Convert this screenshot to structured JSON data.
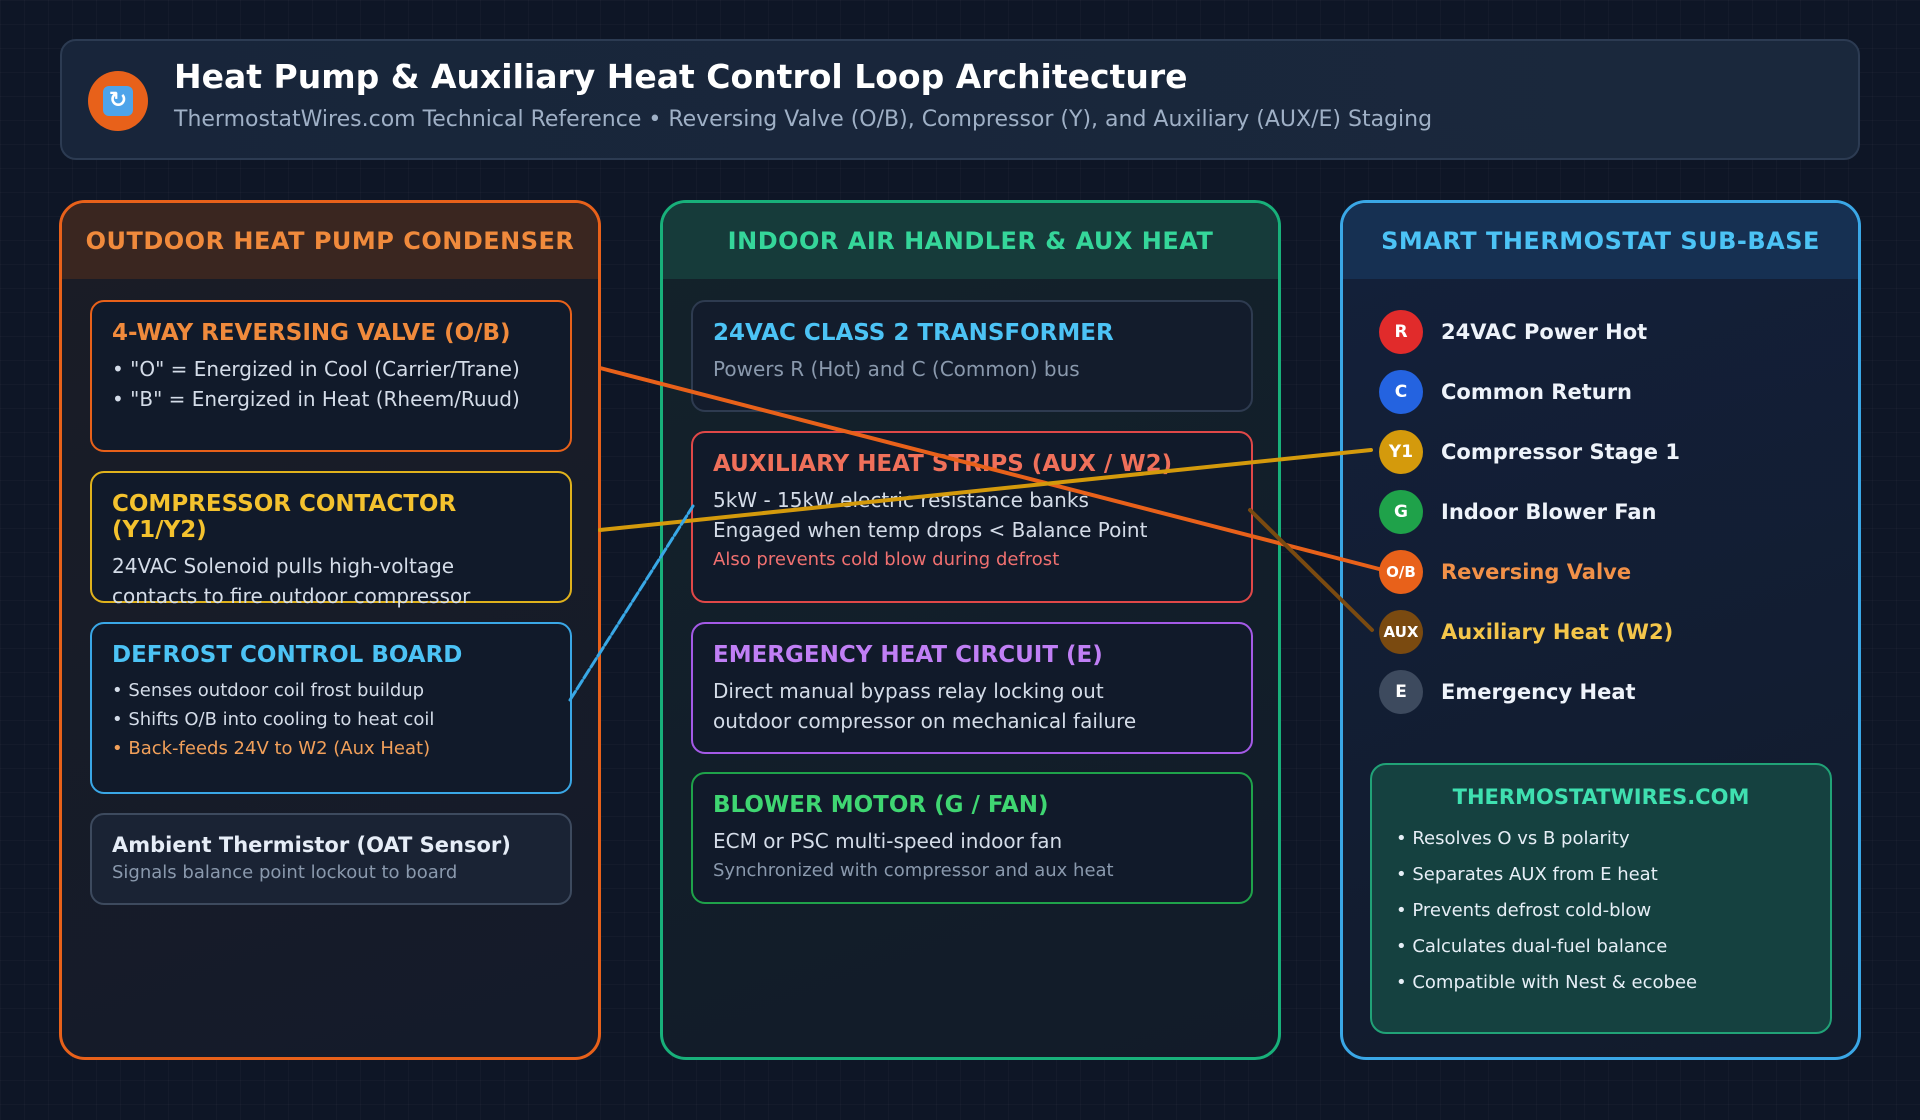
{
  "header": {
    "icon": "refresh-icon",
    "title": "Heat Pump & Auxiliary Heat Control Loop Architecture",
    "subtitle": "ThermostatWires.com Technical Reference • Reversing Valve (O/B), Compressor (Y), and Auxiliary (AUX/E) Staging"
  },
  "outdoor": {
    "title": "OUTDOOR HEAT PUMP CONDENSER",
    "reversing_valve": {
      "title": "4-WAY REVERSING VALVE (O/B)",
      "lines": [
        "• \"O\" = Energized in Cool (Carrier/Trane)",
        "• \"B\" = Energized in Heat (Rheem/Ruud)"
      ]
    },
    "compressor": {
      "title": "COMPRESSOR CONTACTOR (Y1/Y2)",
      "lines": [
        "24VAC Solenoid pulls high-voltage",
        "contacts to fire outdoor compressor"
      ]
    },
    "defrost": {
      "title": "DEFROST CONTROL BOARD",
      "lines": [
        "• Senses outdoor coil frost buildup",
        "• Shifts O/B into cooling to heat coil"
      ],
      "highlight": "• Back-feeds 24V to W2 (Aux Heat)"
    },
    "thermistor": {
      "title": "Ambient Thermistor (OAT Sensor)",
      "line": "Signals balance point lockout to board"
    }
  },
  "indoor": {
    "title": "INDOOR AIR HANDLER & AUX HEAT",
    "transformer": {
      "title": "24VAC CLASS 2 TRANSFORMER",
      "line": "Powers R (Hot) and C (Common) bus"
    },
    "aux_strips": {
      "title": "AUXILIARY HEAT STRIPS (AUX / W2)",
      "lines": [
        "5kW - 15kW electric resistance banks",
        "Engaged when temp drops < Balance Point"
      ],
      "highlight": "Also prevents cold blow during defrost"
    },
    "emergency": {
      "title": "EMERGENCY HEAT CIRCUIT (E)",
      "lines": [
        "Direct manual bypass relay locking out",
        "outdoor compressor on mechanical failure"
      ]
    },
    "blower": {
      "title": "BLOWER MOTOR (G / FAN)",
      "line": "ECM or PSC multi-speed indoor fan",
      "sub": "Synchronized with compressor and aux heat"
    }
  },
  "thermostat": {
    "title": "SMART THERMOSTAT SUB-BASE",
    "terminals": [
      {
        "code": "R",
        "label": "24VAC Power Hot",
        "color": "#e12b2b",
        "label_color": "#eef3fa"
      },
      {
        "code": "C",
        "label": "Common Return",
        "color": "#2463e0",
        "label_color": "#eef3fa"
      },
      {
        "code": "Y1",
        "label": "Compressor Stage 1",
        "color": "#d49a0c",
        "label_color": "#eef3fa"
      },
      {
        "code": "G",
        "label": "Indoor Blower Fan",
        "color": "#1fa24a",
        "label_color": "#eef3fa"
      },
      {
        "code": "O/B",
        "label": "Reversing Valve",
        "color": "#e8611a",
        "label_color": "#f29148"
      },
      {
        "code": "AUX",
        "label": "Auxiliary Heat (W2)",
        "color": "#7a4a10",
        "label_color": "#f4c64a"
      },
      {
        "code": "E",
        "label": "Emergency Heat",
        "color": "#3d4a5e",
        "label_color": "#eef3fa"
      }
    ],
    "promo": {
      "title": "THERMOSTATWIRES.COM",
      "items": [
        "• Resolves O vs B polarity",
        "• Separates AUX from E heat",
        "• Prevents defrost cold-blow",
        "• Calculates dual-fuel balance",
        "• Compatible with Nest & ecobee"
      ]
    }
  },
  "colors": {
    "outdoor_accent": "#e8611a",
    "indoor_accent": "#18b07a",
    "thermostat_accent": "#3aa7e6",
    "compressor_wire": "#d49a0c",
    "defrost_wire": "#39a8e6",
    "aux_wire": "#7a4a10"
  }
}
